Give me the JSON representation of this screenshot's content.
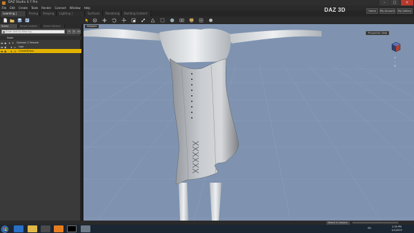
{
  "window": {
    "title": "DAZ Studio 4.7 Pro",
    "controls": {
      "minimize": "–",
      "maximize": "□",
      "close": "✕"
    }
  },
  "menubar": {
    "items": [
      "File",
      "Edit",
      "Create",
      "Tools",
      "Render",
      "Connect",
      "Window",
      "Help"
    ]
  },
  "tabs": [
    "Learning | Creating",
    "Posing",
    "Shaping",
    "Lighting | Camera",
    "Surfaces",
    "Rendering",
    "Building Content"
  ],
  "brand": {
    "name": "DAZ 3D"
  },
  "top_links": [
    "Home",
    "My Account",
    "My Gallery"
  ],
  "left_panel": {
    "tabs": [
      "Scene",
      "Smart Content",
      "Scene Options"
    ],
    "search_placeholder": "Enter text to filter by...",
    "buttons": {
      "add": "+",
      "remove": "×",
      "menu": "≡"
    },
    "tree_header": "Node",
    "rows": [
      {
        "label": "Genesis 2 Female"
      },
      {
        "label": "Hair"
      },
      {
        "label": "CorsetDress"
      }
    ],
    "selected_index": 2
  },
  "viewport": {
    "tab_label": "Viewport",
    "camera_label": "Perspective View",
    "camera_dropdown": "▾",
    "nav_controls": [
      "+",
      "–",
      "↻"
    ]
  },
  "statusbar": {
    "search_placeholder": "Search in Lessons",
    "progress": 0
  },
  "taskbar": {
    "tray_lang": "EN",
    "time": "2:35 PM",
    "date": "1/1/2015"
  },
  "colors": {
    "accent": "#e3b300",
    "viewport_bg": "#7f93b0",
    "panel_bg": "#3a3a3a",
    "taskbar_bg": "#1b2633"
  }
}
